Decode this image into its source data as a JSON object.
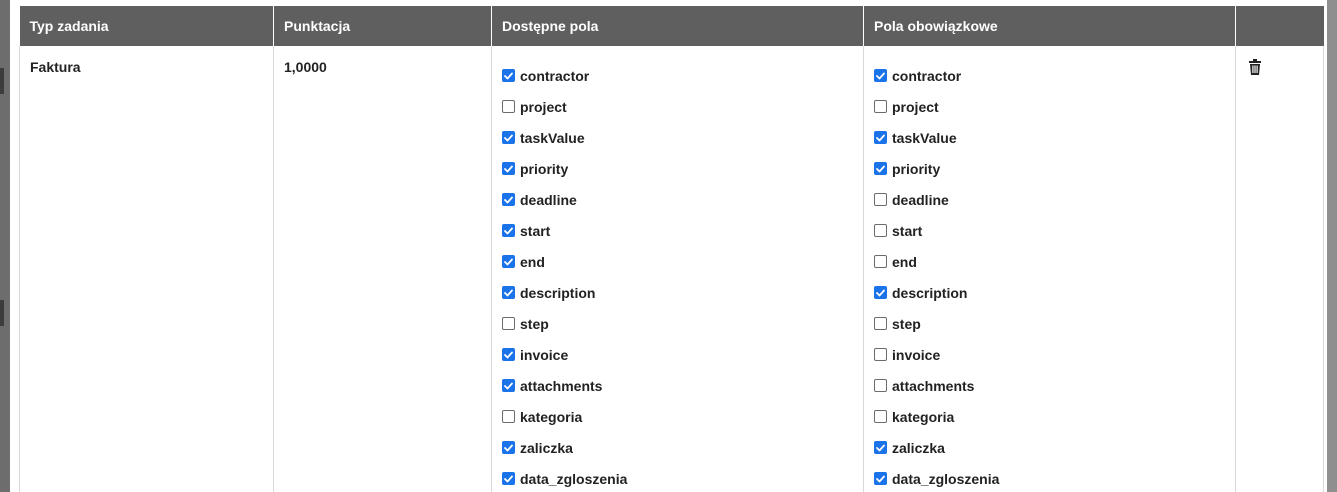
{
  "table": {
    "headers": [
      "Typ zadania",
      "Punktacja",
      "Dostępne pola",
      "Pola obowiązkowe",
      ""
    ],
    "rows": [
      {
        "task_type": "Faktura",
        "score": "1,0000",
        "available_fields": [
          {
            "label": "contractor",
            "checked": true
          },
          {
            "label": "project",
            "checked": false
          },
          {
            "label": "taskValue",
            "checked": true
          },
          {
            "label": "priority",
            "checked": true
          },
          {
            "label": "deadline",
            "checked": true
          },
          {
            "label": "start",
            "checked": true
          },
          {
            "label": "end",
            "checked": true
          },
          {
            "label": "description",
            "checked": true
          },
          {
            "label": "step",
            "checked": false
          },
          {
            "label": "invoice",
            "checked": true
          },
          {
            "label": "attachments",
            "checked": true
          },
          {
            "label": "kategoria",
            "checked": false
          },
          {
            "label": "zaliczka",
            "checked": true
          },
          {
            "label": "data_zgloszenia",
            "checked": true
          }
        ],
        "required_fields": [
          {
            "label": "contractor",
            "checked": true
          },
          {
            "label": "project",
            "checked": false
          },
          {
            "label": "taskValue",
            "checked": true
          },
          {
            "label": "priority",
            "checked": true
          },
          {
            "label": "deadline",
            "checked": false
          },
          {
            "label": "start",
            "checked": false
          },
          {
            "label": "end",
            "checked": false
          },
          {
            "label": "description",
            "checked": true
          },
          {
            "label": "step",
            "checked": false
          },
          {
            "label": "invoice",
            "checked": false
          },
          {
            "label": "attachments",
            "checked": false
          },
          {
            "label": "kategoria",
            "checked": false
          },
          {
            "label": "zaliczka",
            "checked": true
          },
          {
            "label": "data_zgloszenia",
            "checked": true
          }
        ],
        "delete_icon": "trash-icon"
      }
    ]
  },
  "colors": {
    "header_bg": "#5f5f5f",
    "header_text": "#ffffff",
    "checkbox_checked": "#1a73e8",
    "backdrop": "#8f8f8f"
  }
}
